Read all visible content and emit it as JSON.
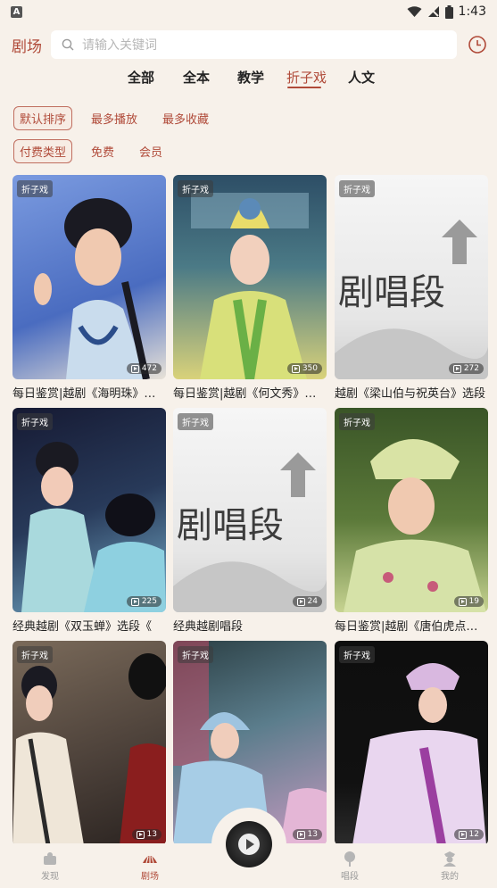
{
  "status": {
    "time": "1:43",
    "left_icon": "A"
  },
  "header": {
    "title": "剧场",
    "search_placeholder": "请输入关键词"
  },
  "categories": [
    "全部",
    "全本",
    "教学",
    "折子戏",
    "人文"
  ],
  "active_category": "折子戏",
  "sort_filters": [
    "默认排序",
    "最多播放",
    "最多收藏"
  ],
  "pay_filters": [
    "付费类型",
    "免费",
    "会员"
  ],
  "cards": [
    {
      "tag": "折子戏",
      "count": "472",
      "title": "每日鉴赏|越剧《海明珠》选段",
      "colors": [
        "#6f8fd6",
        "#3c5fb2"
      ]
    },
    {
      "tag": "折子戏",
      "count": "350",
      "title": "每日鉴赏|越剧《何文秀》片段",
      "colors": [
        "#3c6a7a",
        "#c8d96a"
      ]
    },
    {
      "tag": "折子戏",
      "count": "272",
      "title": "越剧《梁山伯与祝英台》选段",
      "colors": [
        "#f4f4f4",
        "#bfbfbf"
      ]
    },
    {
      "tag": "折子戏",
      "count": "225",
      "title": "经典越剧《双玉蝉》选段《",
      "colors": [
        "#1b1f3a",
        "#6fa7c4"
      ]
    },
    {
      "tag": "折子戏",
      "count": "24",
      "title": "经典越剧唱段",
      "colors": [
        "#f4f4f4",
        "#bfbfbf"
      ]
    },
    {
      "tag": "折子戏",
      "count": "19",
      "title": "每日鉴赏|越剧《唐伯虎点秋香》",
      "colors": [
        "#3f5a2a",
        "#c9d48c"
      ]
    },
    {
      "tag": "折子戏",
      "count": "13",
      "title": "",
      "colors": [
        "#6a5a4a",
        "#2b2420"
      ]
    },
    {
      "tag": "折子戏",
      "count": "13",
      "title": "",
      "colors": [
        "#5c8ab0",
        "#c8a0c0"
      ]
    },
    {
      "tag": "折子戏",
      "count": "12",
      "title": "",
      "colors": [
        "#111111",
        "#b08ab8"
      ]
    }
  ],
  "tabs": [
    {
      "label": "发现",
      "icon": "discover-icon"
    },
    {
      "label": "剧场",
      "icon": "theater-icon"
    },
    {
      "label": "唱段",
      "icon": "aria-icon"
    },
    {
      "label": "我的",
      "icon": "profile-icon"
    }
  ],
  "accent": "#b04a39"
}
